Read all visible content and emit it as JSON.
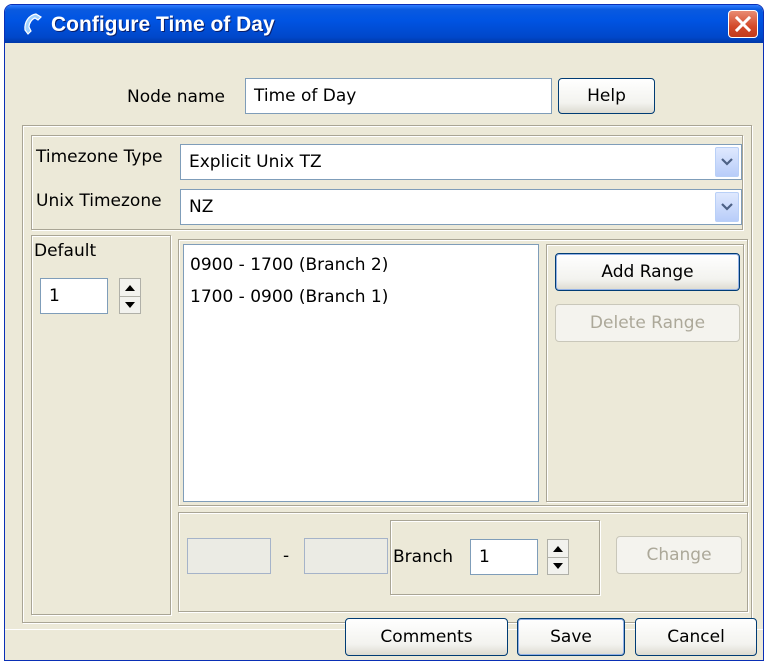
{
  "window": {
    "title": "Configure Time of Day",
    "title_icon": "phone-handset-icon",
    "close_icon": "close-icon"
  },
  "node": {
    "label": "Node name",
    "value": "Time of Day",
    "help_label": "Help"
  },
  "timezone": {
    "type_label": "Timezone Type",
    "type_value": "Explicit Unix TZ",
    "unix_label": "Unix Timezone",
    "unix_value": "NZ"
  },
  "default": {
    "label": "Default",
    "value": "1"
  },
  "ranges": {
    "items": [
      "0900 - 1700 (Branch 2)",
      "1700 - 0900 (Branch 1)"
    ],
    "add_label": "Add Range",
    "delete_label": "Delete Range"
  },
  "editor": {
    "start_value": "",
    "separator": "-",
    "end_value": "",
    "branch_label": "Branch",
    "branch_value": "1",
    "change_label": "Change"
  },
  "footer": {
    "comments_label": "Comments",
    "save_label": "Save",
    "cancel_label": "Cancel"
  },
  "colors": {
    "titlebar": "#0054e3",
    "close": "#d34a2a",
    "dialog_bg": "#ece9d8",
    "field_border": "#7f9db9"
  }
}
